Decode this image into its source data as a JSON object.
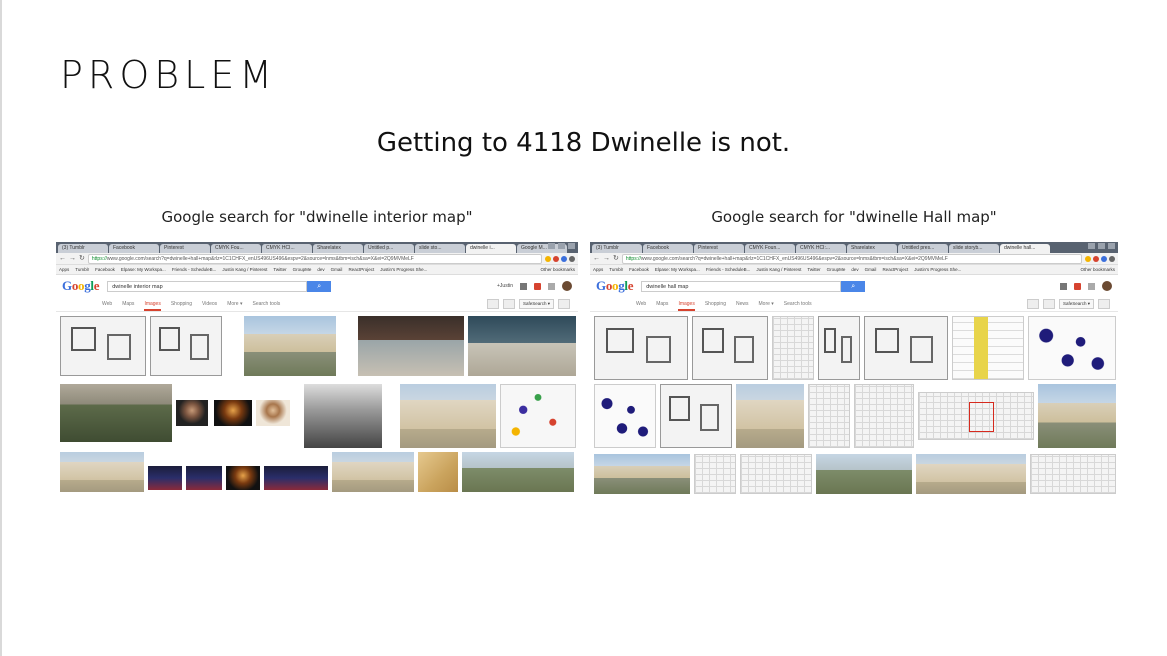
{
  "slide": {
    "title": "PROBLEM",
    "subtitle": "Getting to 4118 Dwinelle is not."
  },
  "left": {
    "caption": "Google search for \"dwinelle interior map\"",
    "browser": {
      "tabs": [
        {
          "label": "(3) Tumblr",
          "active": false
        },
        {
          "label": "Facebook",
          "active": false
        },
        {
          "label": "Pinterest",
          "active": false
        },
        {
          "label": "CMYK Fou...",
          "active": false
        },
        {
          "label": "CMYK HCI...",
          "active": false
        },
        {
          "label": "Sharelatex",
          "active": false
        },
        {
          "label": "Untitled p...",
          "active": false
        },
        {
          "label": "slide sto...",
          "active": false
        },
        {
          "label": "dwinelle i...",
          "active": true
        },
        {
          "label": "Google M...",
          "active": false
        }
      ],
      "url_scheme": "https://",
      "url_rest": "www.google.com/search?q=dwinelle+hall+map&rlz=1C1CHFX_enUS496US496&espv=2&source=lnms&tbm=isch&sa=X&ei=2Q9MVMeLF",
      "bookmarks": [
        "Apps",
        "Tumblr",
        "Facebook",
        "Elpase: My Workspa...",
        "Friends - ScheduleB...",
        "Justin Kang / Pinterest",
        "Twitter",
        "GroupMe",
        "dev",
        "Gmail",
        "ReactProject",
        "Justin's Progress She..."
      ],
      "other_bookmarks": "Other bookmarks"
    },
    "google": {
      "logo_letters": [
        "G",
        "o",
        "o",
        "g",
        "l",
        "e"
      ],
      "query": "dwinelle interior map",
      "user": "+Justin",
      "tabs": [
        {
          "label": "Web",
          "selected": false
        },
        {
          "label": "Maps",
          "selected": false
        },
        {
          "label": "Images",
          "selected": true
        },
        {
          "label": "Shopping",
          "selected": false
        },
        {
          "label": "Videos",
          "selected": false
        },
        {
          "label": "More ▾",
          "selected": false
        },
        {
          "label": "Search tools",
          "selected": false
        }
      ],
      "safe_search": "SafeSearch ▾"
    }
  },
  "right": {
    "caption": "Google search for \"dwinelle Hall map\"",
    "browser": {
      "tabs": [
        {
          "label": "(3) Tumblr",
          "active": false
        },
        {
          "label": "Facebook",
          "active": false
        },
        {
          "label": "Pinterest",
          "active": false
        },
        {
          "label": "CMYK Foun...",
          "active": false
        },
        {
          "label": "CMYK HCI:...",
          "active": false
        },
        {
          "label": "Sharelatex",
          "active": false
        },
        {
          "label": "Untitled pres...",
          "active": false
        },
        {
          "label": "slide storyb...",
          "active": false
        },
        {
          "label": "dwinelle hall...",
          "active": true
        }
      ],
      "url_scheme": "https://",
      "url_rest": "www.google.com/search?q=dwinelle+hall+map&rlz=1C1CHFX_enUS496US496&espv=2&source=lnms&tbm=isch&sa=X&ei=2Q9MVMeLF",
      "bookmarks": [
        "Apps",
        "Tumblr",
        "Facebook",
        "Elpase: My Workspa...",
        "Friends - ScheduleB...",
        "Justin Kang / Pinterest",
        "Twitter",
        "GroupMe",
        "dev",
        "Gmail",
        "ReactProject",
        "Justin's Progress She..."
      ],
      "other_bookmarks": "Other bookmarks"
    },
    "google": {
      "logo_letters": [
        "G",
        "o",
        "o",
        "g",
        "l",
        "e"
      ],
      "query": "dwinelle hall map",
      "tabs": [
        {
          "label": "Web",
          "selected": false
        },
        {
          "label": "Maps",
          "selected": false
        },
        {
          "label": "Images",
          "selected": true
        },
        {
          "label": "Shopping",
          "selected": false
        },
        {
          "label": "News",
          "selected": false
        },
        {
          "label": "More ▾",
          "selected": false
        },
        {
          "label": "Search tools",
          "selected": false
        }
      ],
      "safe_search": "SafeSearch ▾"
    }
  },
  "icons": {
    "back": "back-arrow-icon",
    "forward": "forward-arrow-icon",
    "reload": "reload-icon",
    "search": "magnifier-icon",
    "mic": "microphone-icon",
    "camera": "camera-icon",
    "settings": "gear-icon",
    "apps": "grid-icon",
    "notifications": "bell-icon",
    "share": "share-icon"
  },
  "colors": {
    "google_blue": "#3b6fdc",
    "google_red": "#d6432f",
    "google_yellow": "#f4b400",
    "google_green": "#0f9d58",
    "search_button": "#4a86e8",
    "tabbar": "#586270"
  }
}
